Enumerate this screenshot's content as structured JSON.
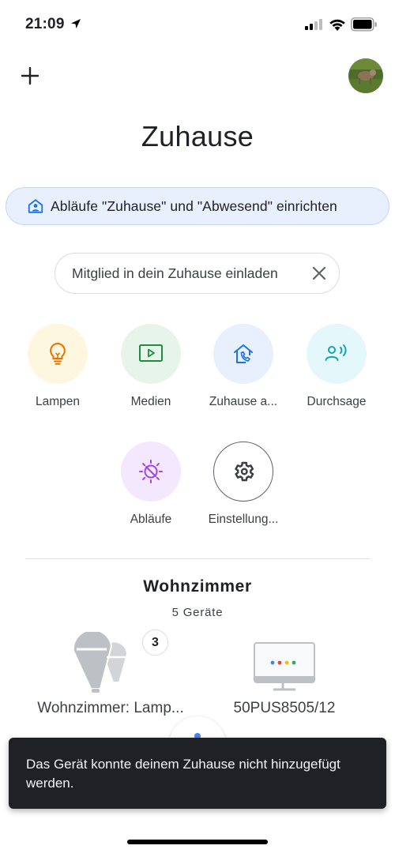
{
  "status_bar": {
    "time": "21:09"
  },
  "header": {
    "title": "Zuhause",
    "add_icon": "plus-icon",
    "avatar_icon": "profile-avatar"
  },
  "setup_banner": {
    "label": "Abläufe \"Zuhause\" und \"Abwesend\" einrichten",
    "icon": "home-person-icon"
  },
  "invite_chip": {
    "label": "Mitglied in dein Zuhause einladen",
    "close_icon": "close-icon"
  },
  "shortcuts": [
    {
      "label": "Lampen",
      "icon": "lightbulb-icon",
      "bg": "#fef7e0",
      "fg": "#e37400"
    },
    {
      "label": "Medien",
      "icon": "play-screen-icon",
      "bg": "#e6f4ea",
      "fg": "#1e8e3e"
    },
    {
      "label": "Zuhause a...",
      "icon": "home-phone-icon",
      "bg": "#e8f0fe",
      "fg": "#1a73e8"
    },
    {
      "label": "Durchsage",
      "icon": "broadcast-person-icon",
      "bg": "#e4f7fb",
      "fg": "#12a4af"
    },
    {
      "label": "Abläufe",
      "icon": "routine-sun-icon",
      "bg": "#f3e8fd",
      "fg": "#a142f4"
    },
    {
      "label": "Einstellung...",
      "icon": "gear-icon",
      "bg": "#ffffff",
      "fg": "#3c4043"
    }
  ],
  "room": {
    "title": "Wohnzimmer",
    "subtitle": "5 Geräte",
    "devices": [
      {
        "name": "Wohnzimmer: Lamp...",
        "icon": "lamp-group-icon",
        "badge": "3"
      },
      {
        "name": "50PUS8505/12",
        "icon": "tv-icon"
      }
    ]
  },
  "snackbar": {
    "message": "Das Gerät konnte deinem Zuhause nicht hinzugefügt werden."
  },
  "colors": {
    "google_blue": "#4285f4",
    "google_red": "#ea4335",
    "google_yellow": "#fbbc04",
    "google_green": "#34a853"
  }
}
